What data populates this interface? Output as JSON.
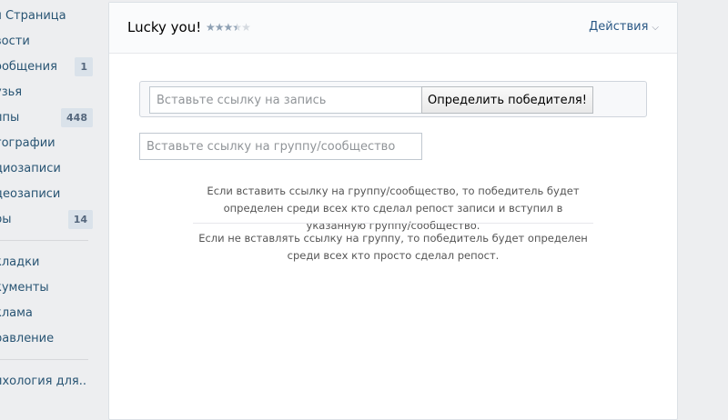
{
  "sidebar": {
    "items": [
      {
        "label": "я Страница",
        "badge": ""
      },
      {
        "label": "вости",
        "badge": ""
      },
      {
        "label": "ообщения",
        "badge": "1"
      },
      {
        "label": "узья",
        "badge": ""
      },
      {
        "label": "ппы",
        "badge": "448"
      },
      {
        "label": "тографии",
        "badge": ""
      },
      {
        "label": "диозаписи",
        "badge": ""
      },
      {
        "label": "деозаписи",
        "badge": ""
      },
      {
        "label": "ры",
        "badge": "14"
      },
      {
        "label": "кладки",
        "badge": ""
      },
      {
        "label": "кументы",
        "badge": ""
      },
      {
        "label": "клама",
        "badge": ""
      },
      {
        "label": "равление",
        "badge": ""
      },
      {
        "label": "ихология для..",
        "badge": ""
      }
    ]
  },
  "header": {
    "title": "Lucky you!",
    "rating": 3.5,
    "rating_max": 5,
    "actions_label": "Действия",
    "actions_icon": "chevron-down-icon"
  },
  "form": {
    "post_placeholder": "Вставьте ссылку на запись",
    "post_value": "",
    "winner_button_label": "Определить победителя!",
    "group_placeholder": "Вставьте ссылку на группу/сообщество",
    "group_value": ""
  },
  "info": {
    "line1": "Если вставить ссылку на группу/сообщество, то победитель будет определен среди всех кто сделал репост записи и вступил в указанную группу/сообщество.",
    "line2": "Если не вставлять ссылку на группу, то победитель будет определен среди всех кто просто сделал репост."
  },
  "colors": {
    "background": "#edeef0",
    "link": "#2a5885",
    "sidebar_link": "#285473",
    "badge_bg": "#dae2ea"
  }
}
